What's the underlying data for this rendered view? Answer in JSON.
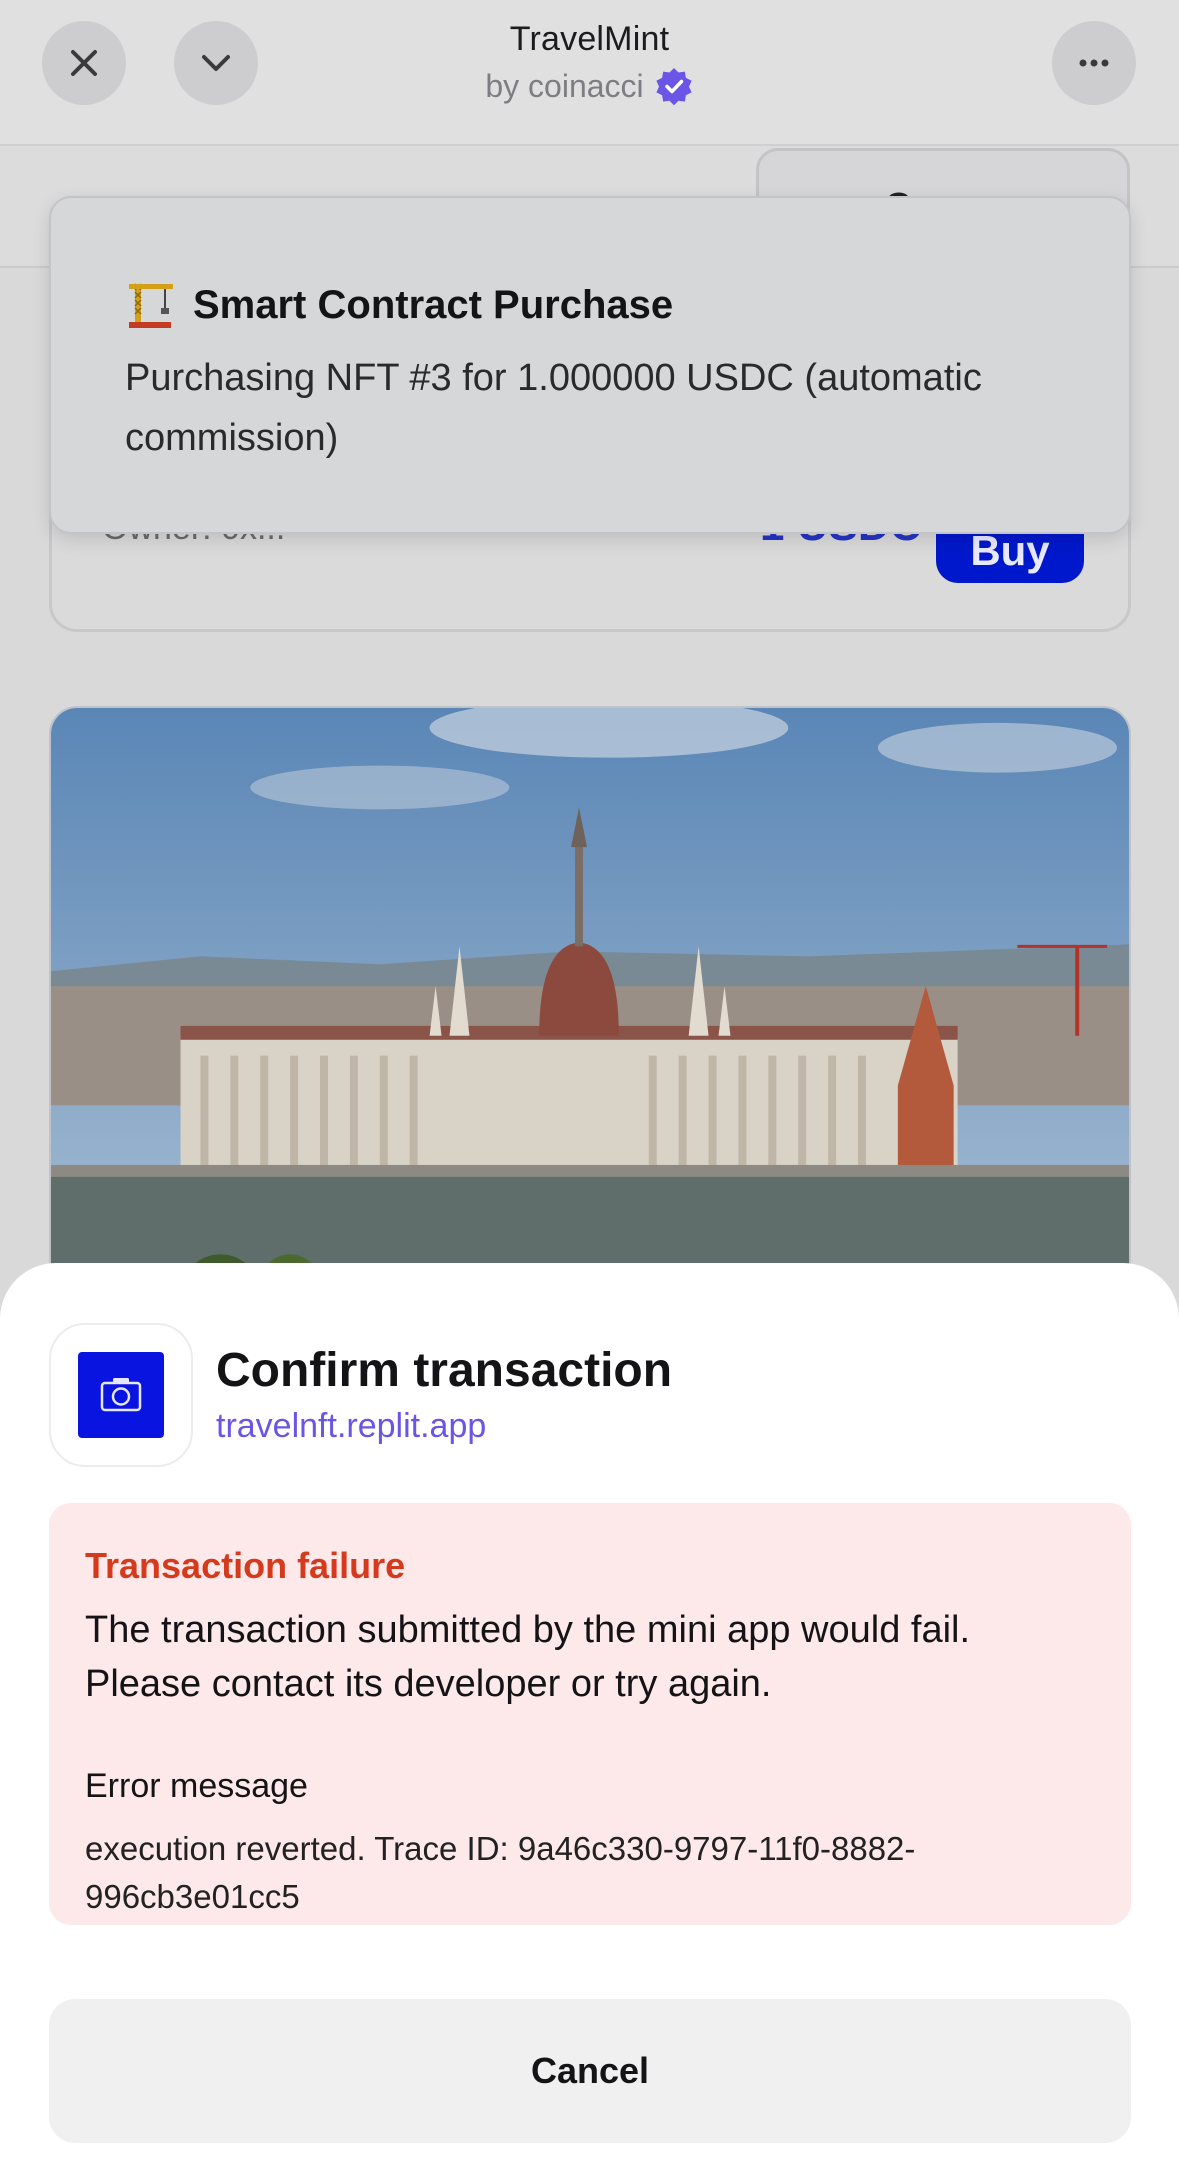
{
  "header": {
    "title": "TravelMint",
    "subtitle": "by coinacci",
    "close_icon": "close-icon",
    "collapse_icon": "chevron-down-icon",
    "more_icon": "more-icon",
    "verified_icon": "verified-badge-icon",
    "verified_color": "#6a55e6"
  },
  "background_page": {
    "connect_label": "Conn",
    "nft_owner": "Owner: 0x...",
    "nft_price": "1 USDC",
    "buy_label": "Buy",
    "accent_color": "#0018cc"
  },
  "toast": {
    "icon": "construction-crane-icon",
    "title": "Smart Contract Purchase",
    "body": "Purchasing NFT #3 for 1.000000 USDC (automatic commission)"
  },
  "sheet": {
    "app_icon": "camera-icon",
    "title": "Confirm transaction",
    "domain": "travelnft.replit.app",
    "error": {
      "title": "Transaction failure",
      "description": "The transaction submitted by the mini app would fail. Please contact its developer or try again.",
      "message_label": "Error message",
      "message": "execution reverted. Trace ID: 9a46c330-9797-11f0-8882-996cb3e01cc5",
      "title_color": "#d63a1d",
      "background": "#fde8ea"
    },
    "cancel_label": "Cancel"
  }
}
